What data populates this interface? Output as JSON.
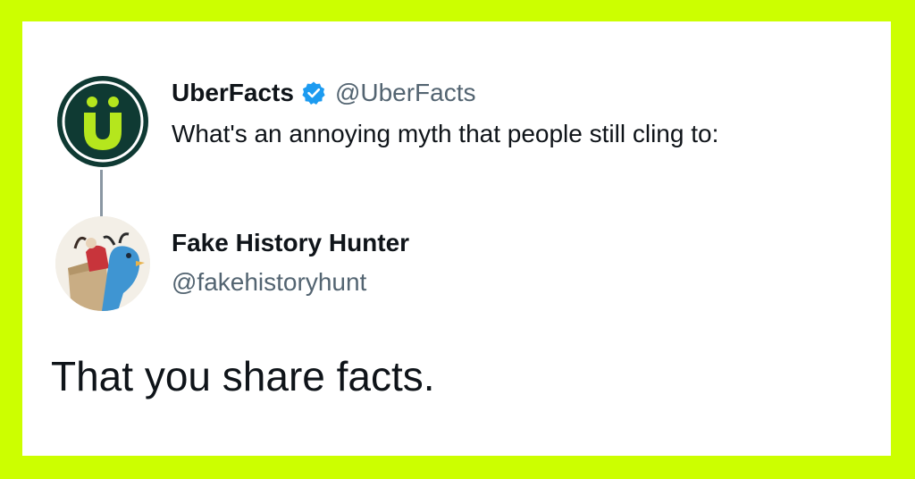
{
  "colors": {
    "border": "#ccff00",
    "card": "#ffffff",
    "text": "#0f1419",
    "muted": "#536471",
    "verified": "#1d9bf0",
    "uberfacts_dark": "#0f3a33",
    "uberfacts_green": "#b5e61d"
  },
  "tweet": {
    "author": {
      "name": "UberFacts",
      "handle": "@UberFacts",
      "verified": true,
      "avatar_icon": "uberfacts-u-logo-icon"
    },
    "text": "What's an annoying myth that people still cling to:"
  },
  "reply": {
    "author": {
      "name": "Fake History Hunter",
      "handle": "@fakehistoryhunt",
      "avatar_icon": "medieval-illustration-avatar"
    },
    "text": "That you share facts."
  }
}
